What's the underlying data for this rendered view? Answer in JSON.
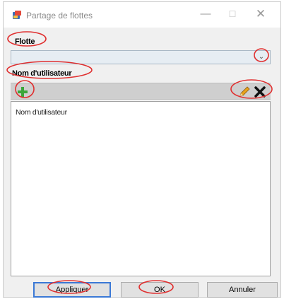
{
  "window": {
    "title": "Partage de flottes",
    "controls": {
      "minimize": "—",
      "maximize": "☐",
      "close": "✕"
    }
  },
  "fleet": {
    "label": "Flotte",
    "selected_value": ""
  },
  "users": {
    "label": "Nom d'utilisateur",
    "list_header": "Nom d'utilisateur",
    "items": []
  },
  "footer": {
    "apply_label": "Appliquer",
    "ok_label": "OK",
    "cancel_label": "Annuler"
  },
  "colors": {
    "annotation_red": "#e03030",
    "accent_blue": "#3b79d6",
    "add_green": "#3aa63a"
  }
}
